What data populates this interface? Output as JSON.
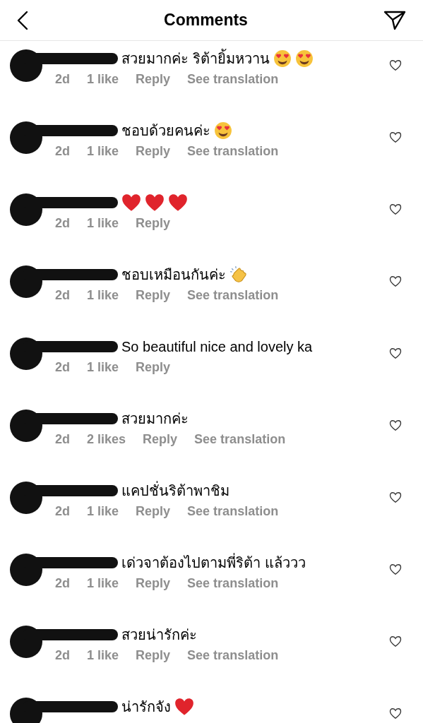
{
  "header": {
    "title": "Comments"
  },
  "comments": [
    {
      "text": "สวยมากค่ะ ริต้ายิ้มหวาน",
      "emojis": [
        {
          "kind": "heart_eyes"
        },
        {
          "kind": "heart_eyes"
        }
      ],
      "meta": {
        "time": "2d",
        "likes": "1 like",
        "reply": "Reply",
        "translation": "See translation"
      }
    },
    {
      "text": "ชอบด้วยคนค่ะ",
      "emojis": [
        {
          "kind": "heart_eyes"
        }
      ],
      "meta": {
        "time": "2d",
        "likes": "1 like",
        "reply": "Reply",
        "translation": "See translation"
      }
    },
    {
      "emojis": [
        {
          "kind": "red_heart"
        },
        {
          "kind": "red_heart"
        },
        {
          "kind": "red_heart"
        }
      ],
      "meta": {
        "time": "2d",
        "likes": "1 like",
        "reply": "Reply"
      }
    },
    {
      "text": "ชอบเหมือนกันค่ะ",
      "emojis": [
        {
          "kind": "clapping_hands"
        }
      ],
      "meta": {
        "time": "2d",
        "likes": "1 like",
        "reply": "Reply",
        "translation": "See translation"
      }
    },
    {
      "text": "So beautiful nice and lovely ka",
      "meta": {
        "time": "2d",
        "likes": "1 like",
        "reply": "Reply"
      }
    },
    {
      "text": "สวยมากค่ะ",
      "meta": {
        "time": "2d",
        "likes": "2 likes",
        "reply": "Reply",
        "translation": "See translation"
      }
    },
    {
      "text": "แคปชั่นริต้าพาชิม",
      "meta": {
        "time": "2d",
        "likes": "1 like",
        "reply": "Reply",
        "translation": "See translation"
      }
    },
    {
      "text": "เด่วจาต้องไปตามพี่ริต้า แล้ววว",
      "meta": {
        "time": "2d",
        "likes": "1 like",
        "reply": "Reply",
        "translation": "See translation"
      }
    },
    {
      "text": "สวยน่ารักค่ะ",
      "meta": {
        "time": "2d",
        "likes": "1 like",
        "reply": "Reply",
        "translation": "See translation"
      }
    },
    {
      "text": "น่ารักจัง",
      "emojis": [
        {
          "kind": "red_heart"
        }
      ]
    }
  ]
}
